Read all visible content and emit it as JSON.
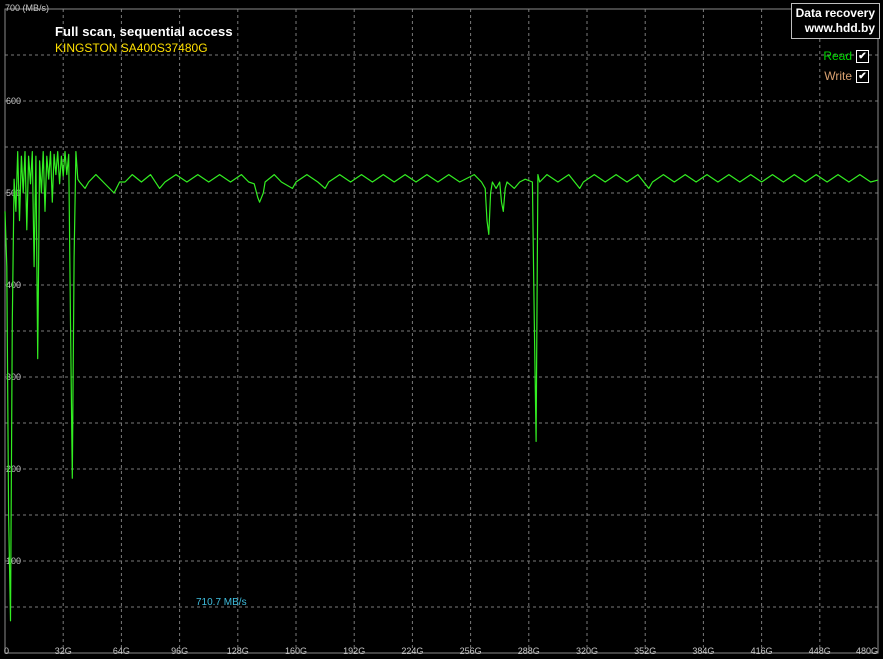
{
  "header": {
    "title": "Full scan, sequential access",
    "subtitle": "KINGSTON SA400S37480G"
  },
  "logo": {
    "line1": "Data recovery",
    "line2": "www.hdd.by"
  },
  "legend": [
    {
      "label": "Read",
      "checked": true,
      "checkmark": "✔",
      "color": "#00d800"
    },
    {
      "label": "Write",
      "checked": true,
      "checkmark": "✔",
      "color": "#d8a070"
    }
  ],
  "max_speed_label": "710.7 MB/s",
  "colors": {
    "background": "#000000",
    "grid": "#7a7a7a",
    "read_series": "#33ee22",
    "tick_labels": "#c8c8c8"
  },
  "chart_data": {
    "type": "line",
    "title": "Full scan, sequential access",
    "subtitle": "KINGSTON SA400S37480G",
    "ylabel": "700 (MB/s)",
    "xlabel": "",
    "ylim": [
      0,
      700
    ],
    "xlim": [
      0,
      480
    ],
    "y_ticks": [
      100,
      200,
      300,
      400,
      500,
      600
    ],
    "y_tick_labels": [
      "100",
      "200",
      "300",
      "400",
      "500",
      "600"
    ],
    "x_ticks": [
      0,
      32,
      64,
      96,
      128,
      160,
      192,
      224,
      256,
      288,
      320,
      352,
      384,
      416,
      448,
      480
    ],
    "x_tick_labels": [
      "0",
      "32G",
      "64G",
      "96G",
      "128G",
      "160G",
      "192G",
      "224G",
      "256G",
      "288G",
      "320G",
      "352G",
      "384G",
      "416G",
      "448G",
      "480G"
    ],
    "grid": true,
    "legend_position": "top-right",
    "series": [
      {
        "name": "Read",
        "color": "#33ee22",
        "baseline": 512,
        "points": [
          [
            0,
            480
          ],
          [
            1,
            420
          ],
          [
            2,
            150
          ],
          [
            3,
            35
          ],
          [
            4,
            360
          ],
          [
            5,
            515
          ],
          [
            6,
            480
          ],
          [
            7,
            545
          ],
          [
            8,
            470
          ],
          [
            9,
            540
          ],
          [
            10,
            500
          ],
          [
            11,
            545
          ],
          [
            12,
            460
          ],
          [
            13,
            540
          ],
          [
            14,
            510
          ],
          [
            15,
            545
          ],
          [
            16,
            420
          ],
          [
            17,
            540
          ],
          [
            18,
            320
          ],
          [
            19,
            535
          ],
          [
            20,
            500
          ],
          [
            21,
            545
          ],
          [
            22,
            480
          ],
          [
            23,
            540
          ],
          [
            24,
            515
          ],
          [
            25,
            545
          ],
          [
            26,
            490
          ],
          [
            27,
            542
          ],
          [
            28,
            520
          ],
          [
            29,
            545
          ],
          [
            30,
            510
          ],
          [
            31,
            540
          ],
          [
            32,
            518
          ],
          [
            33,
            545
          ],
          [
            34,
            520
          ],
          [
            35,
            542
          ],
          [
            36,
            360
          ],
          [
            37,
            190
          ],
          [
            38,
            430
          ],
          [
            39,
            545
          ],
          [
            40,
            515
          ],
          [
            41,
            512
          ],
          [
            44,
            505
          ],
          [
            46,
            512
          ],
          [
            50,
            520
          ],
          [
            54,
            512
          ],
          [
            60,
            500
          ],
          [
            63,
            512
          ],
          [
            66,
            512
          ],
          [
            70,
            520
          ],
          [
            75,
            512
          ],
          [
            80,
            520
          ],
          [
            85,
            505
          ],
          [
            88,
            512
          ],
          [
            94,
            520
          ],
          [
            100,
            512
          ],
          [
            106,
            520
          ],
          [
            112,
            512
          ],
          [
            118,
            520
          ],
          [
            124,
            512
          ],
          [
            130,
            520
          ],
          [
            134,
            512
          ],
          [
            137,
            510
          ],
          [
            139,
            495
          ],
          [
            140,
            490
          ],
          [
            142,
            500
          ],
          [
            143,
            512
          ],
          [
            148,
            520
          ],
          [
            152,
            512
          ],
          [
            158,
            505
          ],
          [
            160,
            512
          ],
          [
            166,
            520
          ],
          [
            172,
            512
          ],
          [
            176,
            505
          ],
          [
            178,
            512
          ],
          [
            184,
            520
          ],
          [
            190,
            512
          ],
          [
            196,
            520
          ],
          [
            202,
            512
          ],
          [
            208,
            520
          ],
          [
            214,
            512
          ],
          [
            220,
            520
          ],
          [
            226,
            512
          ],
          [
            232,
            520
          ],
          [
            238,
            512
          ],
          [
            244,
            520
          ],
          [
            250,
            512
          ],
          [
            258,
            520
          ],
          [
            262,
            512
          ],
          [
            264,
            505
          ],
          [
            265,
            470
          ],
          [
            266,
            455
          ],
          [
            267,
            500
          ],
          [
            268,
            512
          ],
          [
            270,
            505
          ],
          [
            272,
            512
          ],
          [
            273,
            490
          ],
          [
            274,
            480
          ],
          [
            275,
            505
          ],
          [
            276,
            512
          ],
          [
            280,
            505
          ],
          [
            283,
            512
          ],
          [
            286,
            515
          ],
          [
            290,
            512
          ],
          [
            291,
            360
          ],
          [
            292,
            230
          ],
          [
            293,
            520
          ],
          [
            294,
            512
          ],
          [
            298,
            520
          ],
          [
            304,
            512
          ],
          [
            310,
            520
          ],
          [
            316,
            505
          ],
          [
            318,
            512
          ],
          [
            324,
            520
          ],
          [
            330,
            512
          ],
          [
            336,
            520
          ],
          [
            342,
            512
          ],
          [
            348,
            520
          ],
          [
            354,
            505
          ],
          [
            356,
            512
          ],
          [
            362,
            520
          ],
          [
            368,
            512
          ],
          [
            374,
            520
          ],
          [
            380,
            512
          ],
          [
            386,
            520
          ],
          [
            392,
            512
          ],
          [
            398,
            520
          ],
          [
            404,
            512
          ],
          [
            410,
            520
          ],
          [
            416,
            512
          ],
          [
            422,
            520
          ],
          [
            428,
            512
          ],
          [
            434,
            520
          ],
          [
            440,
            512
          ],
          [
            446,
            520
          ],
          [
            452,
            512
          ],
          [
            458,
            520
          ],
          [
            464,
            512
          ],
          [
            470,
            520
          ],
          [
            476,
            512
          ],
          [
            480,
            514
          ]
        ]
      },
      {
        "name": "Write",
        "color": "#d8a070",
        "points": []
      }
    ]
  }
}
